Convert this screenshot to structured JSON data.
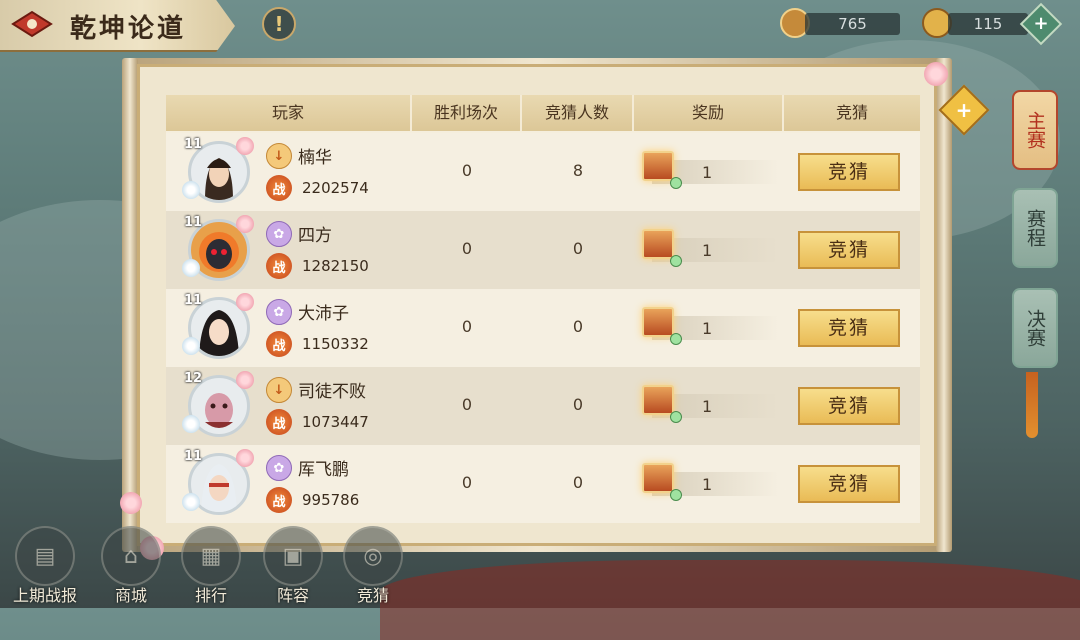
{
  "title": "乾坤论道",
  "currencies": [
    {
      "name": "compass-currency",
      "value": "765"
    },
    {
      "name": "coin-currency",
      "value": "115"
    }
  ],
  "table": {
    "headers": [
      "玩家",
      "胜利场次",
      "竞猜人数",
      "奖励",
      "竞猜"
    ],
    "rows": [
      {
        "level": "11",
        "name": "楠华",
        "rank_icon": "gold",
        "power": "2202574",
        "wins": "0",
        "guessers": "8",
        "reward": "1",
        "button": "竞猜"
      },
      {
        "level": "11",
        "name": "四方",
        "rank_icon": "purple",
        "power": "1282150",
        "wins": "0",
        "guessers": "0",
        "reward": "1",
        "button": "竞猜"
      },
      {
        "level": "11",
        "name": "大沛子",
        "rank_icon": "purple",
        "power": "1150332",
        "wins": "0",
        "guessers": "0",
        "reward": "1",
        "button": "竞猜"
      },
      {
        "level": "12",
        "name": "司徒不败",
        "rank_icon": "gold",
        "power": "1073447",
        "wins": "0",
        "guessers": "0",
        "reward": "1",
        "button": "竞猜"
      },
      {
        "level": "11",
        "name": "厍飞鹏",
        "rank_icon": "purple",
        "power": "995786",
        "wins": "0",
        "guessers": "0",
        "reward": "1",
        "button": "竞猜"
      }
    ]
  },
  "rank_icon_glyph": "战",
  "side_tabs": [
    {
      "label": "主赛",
      "active": true
    },
    {
      "label": "赛程",
      "active": false
    },
    {
      "label": "决赛",
      "active": false
    }
  ],
  "bottom_nav": [
    "上期战报",
    "商城",
    "排行",
    "阵容",
    "竞猜"
  ],
  "colors": {
    "accent_gold": "#e9bb56",
    "active_tab_red": "#b2301e"
  }
}
